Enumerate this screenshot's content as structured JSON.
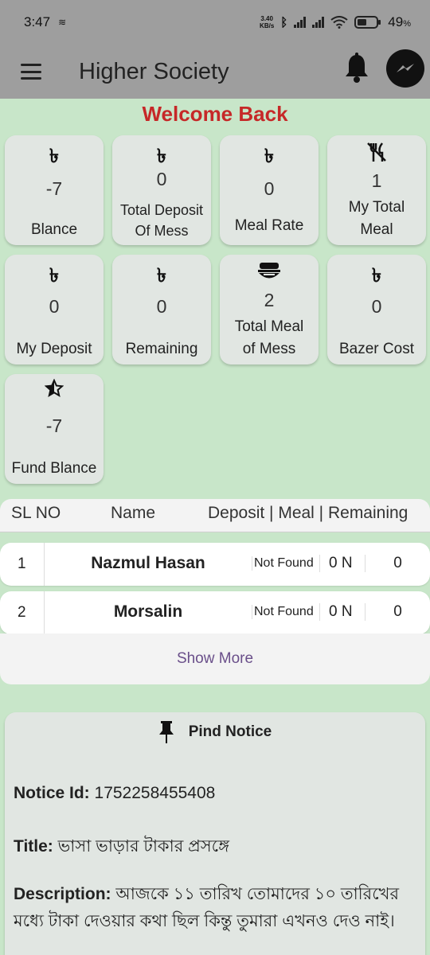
{
  "status_bar": {
    "time": "3:47",
    "net_speed_value": "3.40",
    "net_speed_unit": "KB/s",
    "battery": "49",
    "battery_unit": "%"
  },
  "app_bar": {
    "title": "Higher Society",
    "icons": [
      "menu-icon",
      "bell-icon",
      "messenger-icon"
    ]
  },
  "welcome": "Welcome Back",
  "currency_symbol": "৳",
  "cards": [
    {
      "value": "-7",
      "label": [
        "Blance"
      ],
      "icon": "taka-icon"
    },
    {
      "value": "0",
      "label": [
        "Total Deposit",
        "Of Mess"
      ],
      "icon": "taka-icon"
    },
    {
      "value": "0",
      "label": [
        "Meal Rate"
      ],
      "icon": "taka-icon"
    },
    {
      "value": "1",
      "label": [
        "My Total",
        "Meal"
      ],
      "icon": "no-meal-icon"
    },
    {
      "value": "0",
      "label": [
        "My Deposit"
      ],
      "icon": "taka-icon"
    },
    {
      "value": "0",
      "label": [
        "Remaining"
      ],
      "icon": "taka-icon"
    },
    {
      "value": "2",
      "label": [
        "Total Meal",
        "of Mess"
      ],
      "icon": "rice-bowl-icon"
    },
    {
      "value": "0",
      "label": [
        "Bazer Cost"
      ],
      "icon": "taka-icon"
    },
    {
      "value": "-7",
      "label": [
        "Fund Blance"
      ],
      "icon": "star-icon"
    }
  ],
  "table": {
    "headers": {
      "sl": "SL NO",
      "name": "Name",
      "cols": "Deposit | Meal | Remaining"
    },
    "rows": [
      {
        "sl": "1",
        "name": "Nazmul Hasan",
        "deposit": "Not Found",
        "meal": "0 N",
        "remaining": "0"
      },
      {
        "sl": "2",
        "name": "Morsalin",
        "deposit": "Not Found",
        "meal": "0 N",
        "remaining": "0"
      }
    ],
    "show_more": "Show More"
  },
  "notice": {
    "heading": "Pind Notice",
    "id_label": "Notice Id:",
    "id_value": "1752258455408",
    "title_label": "Title:",
    "title_value": "ভাসা ভাড়ার টাকার প্রসঙ্গে",
    "desc_label": "Description:",
    "desc_value": "আজকে ১১ তারিখ তোমাদের ১০ তারিখের মধ্যে টাকা দেওয়ার কথা ছিল কিন্তু তুমারা এখনও দেও নাই।"
  },
  "colors": {
    "background": "#c8e6c9",
    "bar": "#9e9e9e",
    "card": "#e1e6e2",
    "welcome": "#c62828",
    "show_more": "#6a4f8a"
  }
}
